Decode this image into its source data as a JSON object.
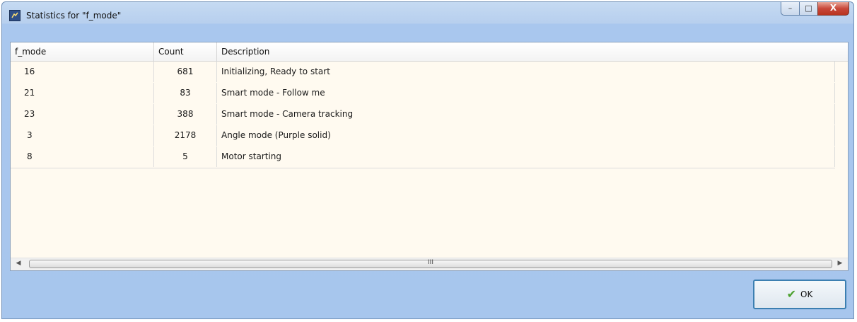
{
  "window": {
    "title": "Statistics for \"f_mode\"",
    "controls": {
      "minimize": "–",
      "maximize": "□",
      "close": "X"
    }
  },
  "table": {
    "columns": [
      "f_mode",
      "Count",
      "Description"
    ],
    "rows": [
      [
        "16",
        "681",
        "Initializing, Ready to start"
      ],
      [
        "21",
        "83",
        "Smart mode - Follow me"
      ],
      [
        "23",
        "388",
        "Smart mode - Camera tracking"
      ],
      [
        "3",
        "2178",
        "Angle mode (Purple solid)"
      ],
      [
        "8",
        "5",
        "Motor starting"
      ]
    ]
  },
  "scrollbar": {
    "left_arrow": "◀",
    "right_arrow": "▶",
    "grip": "III"
  },
  "footer": {
    "ok_label": "OK",
    "ok_icon": "checkmark-icon"
  },
  "colors": {
    "row_background": "#fffaf0",
    "window_background": "#a7c6ed",
    "ok_border": "#3c7fb1"
  }
}
